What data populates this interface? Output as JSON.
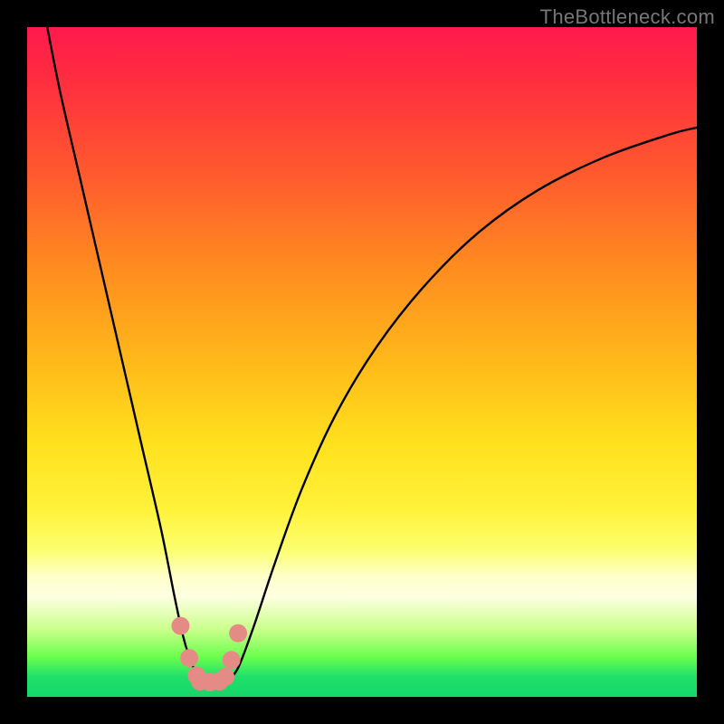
{
  "watermark": {
    "text": "TheBottleneck.com"
  },
  "chart_data": {
    "type": "line",
    "title": "",
    "xlabel": "",
    "ylabel": "",
    "xlim": [
      0,
      100
    ],
    "ylim": [
      0,
      100
    ],
    "grid": false,
    "legend": false,
    "series": [
      {
        "name": "left-branch",
        "x": [
          3,
          5,
          8,
          11,
          14,
          17,
          20,
          22,
          23.3,
          24.2,
          25,
          25.8,
          26.5,
          27.5,
          29
        ],
        "y": [
          100,
          90,
          77,
          64,
          51,
          38,
          25,
          15,
          9,
          6,
          4,
          3,
          2.5,
          2.2,
          2.2
        ]
      },
      {
        "name": "right-branch",
        "x": [
          29,
          30,
          31,
          32,
          34,
          37,
          41,
          46,
          52,
          59,
          67,
          76,
          86,
          96,
          100
        ],
        "y": [
          2.2,
          2.5,
          3.5,
          5.5,
          11,
          20,
          31,
          42,
          52,
          61,
          69,
          75.5,
          80.5,
          84,
          85
        ]
      },
      {
        "name": "valley-marker-left",
        "x": [
          22.9,
          24.2,
          25.3
        ],
        "y": [
          10.6,
          5.8,
          3.2
        ]
      },
      {
        "name": "valley-marker-bottom",
        "x": [
          25.8,
          27.3,
          28.7
        ],
        "y": [
          2.3,
          2.2,
          2.3
        ]
      },
      {
        "name": "valley-marker-right",
        "x": [
          29.6,
          30.5,
          31.5
        ],
        "y": [
          3.0,
          5.5,
          9.5
        ]
      }
    ],
    "colors": {
      "curve": "#000000",
      "marker": "#e58b86",
      "gradient_top": "#ff1a4d",
      "gradient_bottom": "#15d66a"
    }
  }
}
